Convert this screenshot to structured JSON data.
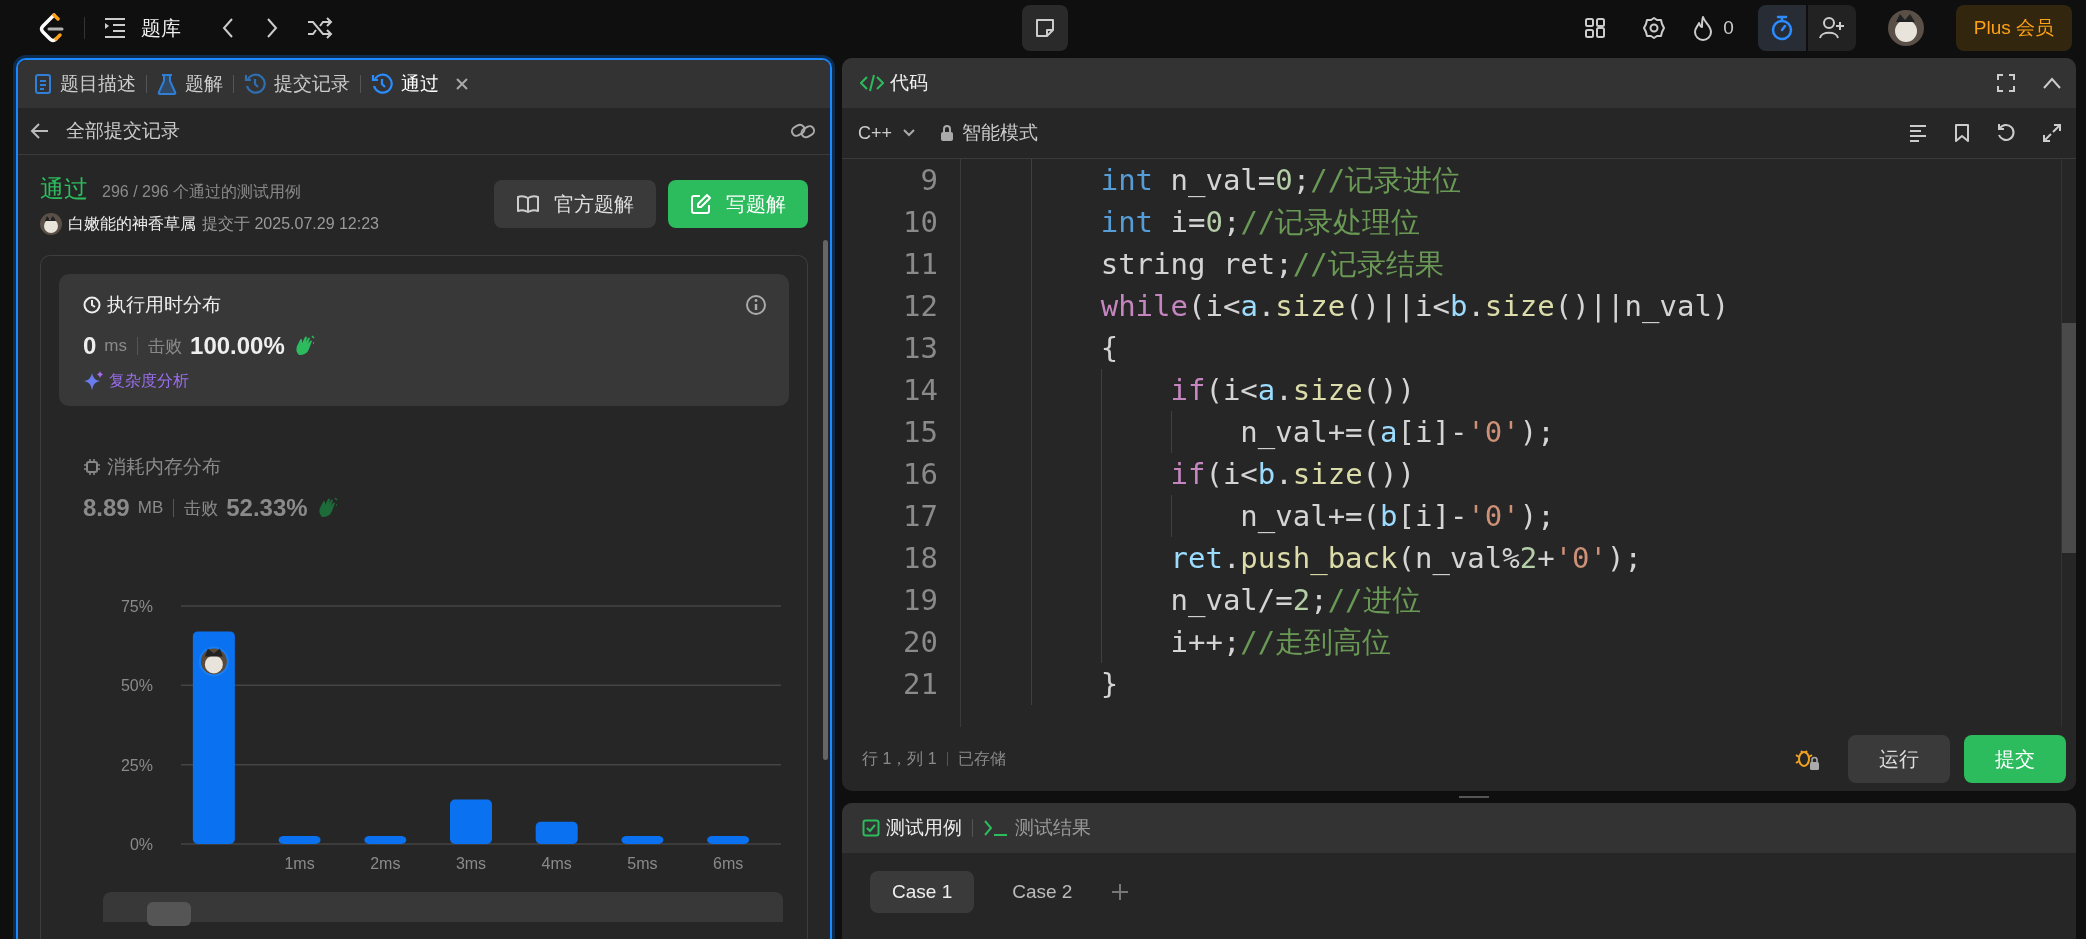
{
  "top_bar": {
    "title": "题库",
    "flame_count": "0",
    "plus_label": "Plus 会员"
  },
  "left_tabs": [
    {
      "label": "题目描述",
      "selected": false,
      "closable": false
    },
    {
      "label": "题解",
      "selected": false,
      "closable": false
    },
    {
      "label": "提交记录",
      "selected": false,
      "closable": false
    },
    {
      "label": "通过",
      "selected": true,
      "closable": true
    }
  ],
  "submission": {
    "back_label": "全部提交记录",
    "status": "通过",
    "passed": "296 / 296 个通过的测试用例",
    "user": "白嫩能的神香草属",
    "submitted_at": "提交于 2025.07.29 12:23",
    "buttons": [
      {
        "label": "官方题解",
        "kind": "secondary"
      },
      {
        "label": "写题解",
        "kind": "primary"
      }
    ]
  },
  "stats": [
    {
      "title": "执行用时分布",
      "value": "0",
      "unit": "ms",
      "beat_label": "击败",
      "percent": "100.00%",
      "selected": true,
      "analysis_link": "复杂度分析"
    },
    {
      "title": "消耗内存分布",
      "value": "8.89",
      "unit": "MB",
      "beat_label": "击败",
      "percent": "52.33%",
      "selected": false
    }
  ],
  "chart_data": {
    "type": "bar",
    "categories": [
      null,
      "1ms",
      "2ms",
      "3ms",
      "4ms",
      "5ms",
      "6ms"
    ],
    "series": [
      {
        "color": "#0a72f0",
        "values": [
          67,
          2.5,
          2.5,
          14,
          7,
          2.5,
          2.5
        ]
      }
    ],
    "ylim": [
      0,
      75
    ],
    "yticks": [
      {
        "value": 0,
        "label": "0%"
      },
      {
        "value": 25,
        "label": "25%"
      },
      {
        "value": 50,
        "label": "50%"
      },
      {
        "value": 75,
        "label": "75%"
      }
    ]
  },
  "editor": {
    "title": "代码",
    "language": "C++",
    "mode": "智能模式",
    "lines": [
      {
        "number": "9",
        "tokens": [
          {
            "t": "        int",
            "kind": "kw"
          },
          {
            "t": " n_val=",
            "kind": "p"
          },
          {
            "t": "0",
            "kind": "num"
          },
          {
            "t": ";",
            "kind": "p"
          },
          {
            "t": "//记录进位",
            "kind": "cm"
          }
        ]
      },
      {
        "number": "10",
        "tokens": [
          {
            "t": "        int",
            "kind": "kw"
          },
          {
            "t": " i=",
            "kind": "p"
          },
          {
            "t": "0",
            "kind": "num"
          },
          {
            "t": ";",
            "kind": "p"
          },
          {
            "t": "//记录处理位",
            "kind": "cm"
          }
        ]
      },
      {
        "number": "11",
        "tokens": [
          {
            "t": "        string ret;",
            "kind": "p"
          },
          {
            "t": "//记录结果",
            "kind": "cm"
          }
        ]
      },
      {
        "number": "12",
        "tokens": [
          {
            "t": "        while",
            "kind": "ctl"
          },
          {
            "t": "(i<",
            "kind": "p"
          },
          {
            "t": "a",
            "kind": "var"
          },
          {
            "t": ".",
            "kind": "p"
          },
          {
            "t": "size",
            "kind": "fn"
          },
          {
            "t": "()||i<",
            "kind": "p"
          },
          {
            "t": "b",
            "kind": "var"
          },
          {
            "t": ".",
            "kind": "p"
          },
          {
            "t": "size",
            "kind": "fn"
          },
          {
            "t": "()||n_val)",
            "kind": "p"
          }
        ]
      },
      {
        "number": "13",
        "tokens": [
          {
            "t": "        {",
            "kind": "p"
          }
        ]
      },
      {
        "number": "14",
        "tokens": [
          {
            "t": "            if",
            "kind": "ctl"
          },
          {
            "t": "(i<",
            "kind": "p"
          },
          {
            "t": "a",
            "kind": "var"
          },
          {
            "t": ".",
            "kind": "p"
          },
          {
            "t": "size",
            "kind": "fn"
          },
          {
            "t": "())",
            "kind": "p"
          }
        ]
      },
      {
        "number": "15",
        "tokens": [
          {
            "t": "                n_val+=(",
            "kind": "p"
          },
          {
            "t": "a",
            "kind": "var"
          },
          {
            "t": "[i]-",
            "kind": "p"
          },
          {
            "t": "'0'",
            "kind": "str"
          },
          {
            "t": ");",
            "kind": "p"
          }
        ]
      },
      {
        "number": "16",
        "tokens": [
          {
            "t": "            if",
            "kind": "ctl"
          },
          {
            "t": "(i<",
            "kind": "p"
          },
          {
            "t": "b",
            "kind": "var"
          },
          {
            "t": ".",
            "kind": "p"
          },
          {
            "t": "size",
            "kind": "fn"
          },
          {
            "t": "())",
            "kind": "p"
          }
        ]
      },
      {
        "number": "17",
        "tokens": [
          {
            "t": "                n_val+=(",
            "kind": "p"
          },
          {
            "t": "b",
            "kind": "var"
          },
          {
            "t": "[i]-",
            "kind": "p"
          },
          {
            "t": "'0'",
            "kind": "str"
          },
          {
            "t": ");",
            "kind": "p"
          }
        ]
      },
      {
        "number": "18",
        "tokens": [
          {
            "t": "            ret",
            "kind": "var"
          },
          {
            "t": ".",
            "kind": "p"
          },
          {
            "t": "push_back",
            "kind": "fn"
          },
          {
            "t": "(n_val%",
            "kind": "p"
          },
          {
            "t": "2",
            "kind": "num"
          },
          {
            "t": "+",
            "kind": "p"
          },
          {
            "t": "'0'",
            "kind": "str"
          },
          {
            "t": ");",
            "kind": "p"
          }
        ]
      },
      {
        "number": "19",
        "tokens": [
          {
            "t": "            n_val/=",
            "kind": "p"
          },
          {
            "t": "2",
            "kind": "num"
          },
          {
            "t": ";",
            "kind": "p"
          },
          {
            "t": "//进位",
            "kind": "cm"
          }
        ]
      },
      {
        "number": "20",
        "tokens": [
          {
            "t": "            i++;",
            "kind": "p"
          },
          {
            "t": "//走到高位",
            "kind": "cm"
          }
        ]
      },
      {
        "number": "21",
        "tokens": [
          {
            "t": "        }",
            "kind": "p"
          }
        ]
      }
    ],
    "status": {
      "position": "行 1，列 1",
      "saved": "已存储"
    },
    "buttons": [
      {
        "label": "运行",
        "kind": "secondary"
      },
      {
        "label": "提交",
        "kind": "primary"
      }
    ]
  },
  "test_panel": {
    "tabs": [
      {
        "label": "测试用例",
        "selected": true
      },
      {
        "label": "测试结果",
        "selected": false
      }
    ],
    "cases": [
      {
        "label": "Case 1",
        "selected": true
      },
      {
        "label": "Case 2",
        "selected": false
      }
    ]
  }
}
